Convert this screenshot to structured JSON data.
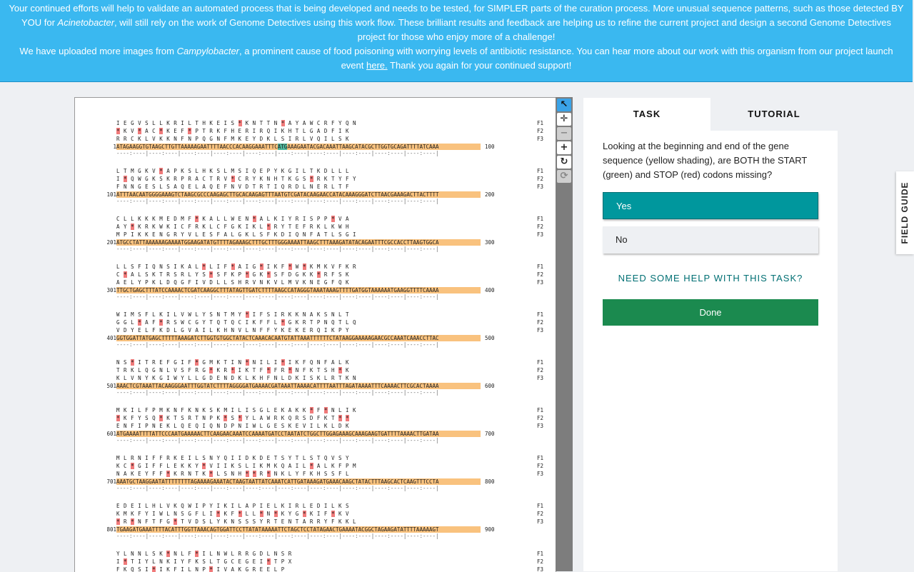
{
  "banner": {
    "line1_a": "Your continued efforts will help to validate an automated process that is being developed and needs to be tested, for SIMPLER parts of the curation process. More unusual sequence patterns, such as those detected BY YOU for ",
    "line1_em": "Acinetobacter",
    "line1_b": ", will still rely on the work of Genome Detectives using this work flow. These brilliant results and feedback are helping us to refine the current project and design a second Genome Detectives project for those who enjoy more of a challenge!",
    "line2_a": "We have uploaded more images from ",
    "line2_em": "Campylobacter",
    "line2_b": ", a prominent cause of food poisoning with worrying levels of antibiotic resistance. You can hear more about our work with this organism from our project launch event ",
    "line2_link": "here.",
    "line2_c": " Thank you again for your continued support!"
  },
  "toolbar": {
    "pointer_icon": "cursor-arrow-icon",
    "move_icon": "move-arrows-icon",
    "zoom_out_icon": "minus-icon",
    "zoom_in_icon": "plus-icon",
    "rotate_icon": "rotate-icon",
    "reset_icon": "reset-icon"
  },
  "sequence_blocks": [
    {
      "start": "1",
      "end": "100",
      "f1": "I E G V S L L K R I L T H K E I S * K N T T N * A Y A W C R F Y Q N",
      "f2": "* K V * A C * K E F * P T R K F H E R I R Q I K H T L G A D F I K",
      "f3": "R R C K L V K K N F N P Q G N F M K E Y D K L S I R L V Q I L S K",
      "seq": "ATAGAAGGTGTAAGCTTGTTAAAAAGAATTTTAACCCACAAGGAAATTTCATGAAAGAATACGACAAATTAAGCATACGCTTGGTGCAGATTTTATCAAA"
    },
    {
      "start": "101",
      "end": "200",
      "f1": "L T M G K V * A P K S L H K S L M S I Q E P Y K G I L T K D L L L",
      "f2": "I * Q W G K S K R P R A C T R V * C R Y K N H T K G S * R K T Y F Y",
      "f3": "F N N G E S L S A Q E L A Q E F N V D T R T I Q R D L N E R L T F",
      "seq": "ATTTAACAATGGGGAAAGTCTAAGCGCCCAAGAGCTTGCACAAGAGTTTAATGTCGATACAAGAACCATACAAAGGGATCTTAACGAAAGACTTACTTTT"
    },
    {
      "start": "201",
      "end": "300",
      "f1": "C L L K K K M E D M F * K A L L W E N * A L K I Y R I S P P * V A",
      "f2": "A Y * K R K W K I C F R K L C F G K I K L * R Y T E F R K L K W H",
      "f3": "M P I K K E N G R Y V L E S F A L G K L S F K D I Q N F A T L S G I",
      "seq": "ATGCCTATTAAAAAAGAAAATGGAAGATATGTTTTAGAAAGCTTTGCTTTGGGAAAATTAAGCTTTAAAGATATACAGAATTTCGCCACCTTAAGTGGCA"
    },
    {
      "start": "301",
      "end": "400",
      "f1": "L L S F I Q N S I K A L * L I F * A I G * I K F * W * K M K V F K R",
      "f2": "C * A L S K T R S R L Y S * S F K P * G K * S F D G K K * R F S K",
      "f3": "A E L Y P K L D Q G F I V D L L S H R V N K V L M V K N E G F Q K",
      "seq": "TTGCTGAGCTTTATCCAAAACTCGATCAAGGCTTTATAGTTGATCTTTTAAGCCATAGGGTAAATAAAGTTTTGATGGTAAAAAATGAAGGTTTTCAAAA"
    },
    {
      "start": "401",
      "end": "500",
      "f1": "W I M S F L K I L V W L Y S N T M Y * I F S I R K K N A K S N L T",
      "f2": "G G L * A F * R S W C G Y T Q T Q C I K F F L * G K R T P N Q T L Q",
      "f3": "V D Y E L F K D L G V A I L K H N V L N F F Y K E K E R Q I K P Y",
      "seq": "GGTGGATTATGAGCTTTTTAAAGATCTTGGTGTGGCTATACTCAAACACAATGTATTAAATTTTTTCTATAAGGAAAAAGAACGCCAAATCAAACCTTAC"
    },
    {
      "start": "501",
      "end": "600",
      "f1": "N S * I T R E F G I F * G M K T I N * N I L I * I K F Q N F A L K",
      "f2": "T R K L Q G N L V S F R G * K R * I K T F * F R * N F K T S H * K",
      "f3": "K L V N Y K G I W Y L L G D E N D K L K H F N L D K I S K L R T K N",
      "seq": "AAACTCGTAAATTACAAGGGAATTTGGTATCTTTTAGGGGATGAAAACGATAAATTAAAACATTTTAATTTAGATAAAATTTCAAAACTTCGCACTAAAA"
    },
    {
      "start": "601",
      "end": "700",
      "f1": "M K I L F P M K N F K N K S K M I L I S G L E K A K K * F * N L I K",
      "f2": "* K F Y S Q * K T S R T N P K * S * Y L A W R K Q R S D F K T * *",
      "f3": "E N F I P N E K L Q E Q I Q N D P N I W L G E S K E V I L K L D K",
      "seq": "ATGAAAATTTTATTCCCAATGAAAAACTTCAAGAACAAATCCAAAATGATCCTAATATCTGGCTTGGAGAAAGCAAAGAAGTGATTTTAAAACTTGATAA"
    },
    {
      "start": "701",
      "end": "800",
      "f1": "M L R N I F F R K E I L S N Y Q I I D K D E T S Y T L S T Q V S Y",
      "f2": "K C * G I F F L E K K Y * V I I K S L I K M K Q A I L * A L K F P M",
      "f3": "N A K E Y F F * K R N T K * L S N H * * R * N K L Y F K H S S F L",
      "seq": "AAATGCTAAGGAATATTTTTTTTAGAAAAGAAATACTAAGTAATTATCAAATCATTGATAAAGATGAAACAAGCTATACTTTAAGCACTCAAGTTTCCTA"
    },
    {
      "start": "801",
      "end": "900",
      "f1": "E D E I L H L V K Q W I P Y I K I L A P I E L K I R L E D I L K S",
      "f2": "K M K F Y I W L N S G F L I * K F * L L * N * K Y G * K I F * K V",
      "f3": "* R * N F T F G * T V D S L Y K N S S S Y R T E N T A R R Y F K K L",
      "seq": "TGAAGATGAAATTTTACATTTGGTTAAACAGTGGATTCCTTATATAAAAATTCTAGCTCCTATAGAACTGAAAATACGGCTAGAAGATATTTTAAAAAGT"
    },
    {
      "start": "",
      "end": "",
      "f1": "Y L N N L S K * N L F * I L N W L R R G D L N S R",
      "f2": "I * T I Y L N K I Y F K S L T G C E G E I * T P X",
      "f3": "F K Q S I * I K F I L N P * I V A K G R E E L P",
      "seq": ""
    }
  ],
  "frame_labels": {
    "f1": "F1",
    "f2": "F2",
    "f3": "F3"
  },
  "ruler": "----:----|----:----|----:----|----:----|----:----|----:----|----:----|----:----|----:----|----:----|",
  "panel": {
    "tab_task": "TASK",
    "tab_tutorial": "TUTORIAL",
    "question": "Looking at the beginning and end of the gene sequence (yellow shading), are BOTH the START (green) and STOP (red) codons missing?",
    "answer_yes": "Yes",
    "answer_no": "No",
    "help_link": "NEED SOME HELP WITH THIS TASK?",
    "done_button": "Done"
  },
  "field_guide": "FIELD GUIDE",
  "colors": {
    "banner": "#3ab8f0",
    "selected_answer": "#00979d",
    "done": "#1b8a4f",
    "seq_highlight": "#f9c27e",
    "stop_codon": "#f07a7a",
    "start_codon": "#4fb89c"
  }
}
